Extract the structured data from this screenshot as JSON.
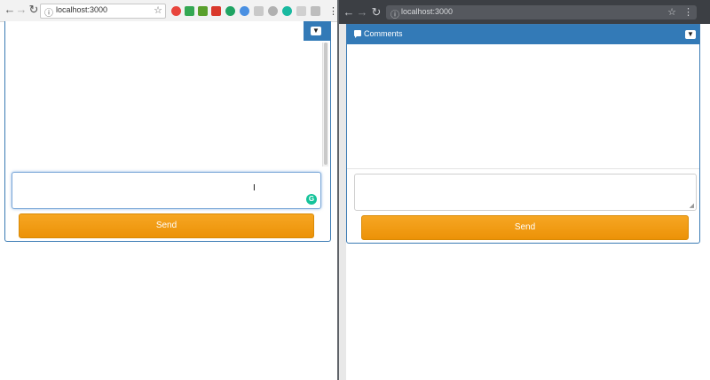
{
  "left_window": {
    "url": "localhost:3000",
    "send_label": "Send"
  },
  "right_window": {
    "url": "localhost:3000",
    "panel_title": "Comments",
    "send_label": "Send"
  },
  "icons": {
    "back": "back-arrow-icon",
    "forward": "forward-arrow-icon",
    "reload": "reload-icon",
    "info": "info-icon",
    "star": "bookmark-star-icon",
    "minimize": "chevron-down-icon",
    "comments": "comment-icon",
    "grammarly": "grammarly-icon",
    "menu": "kebab-menu-icon"
  },
  "colors": {
    "header_blue": "#337ab7",
    "send_orange": "#f0a020",
    "grammarly_green": "#15c39a"
  }
}
